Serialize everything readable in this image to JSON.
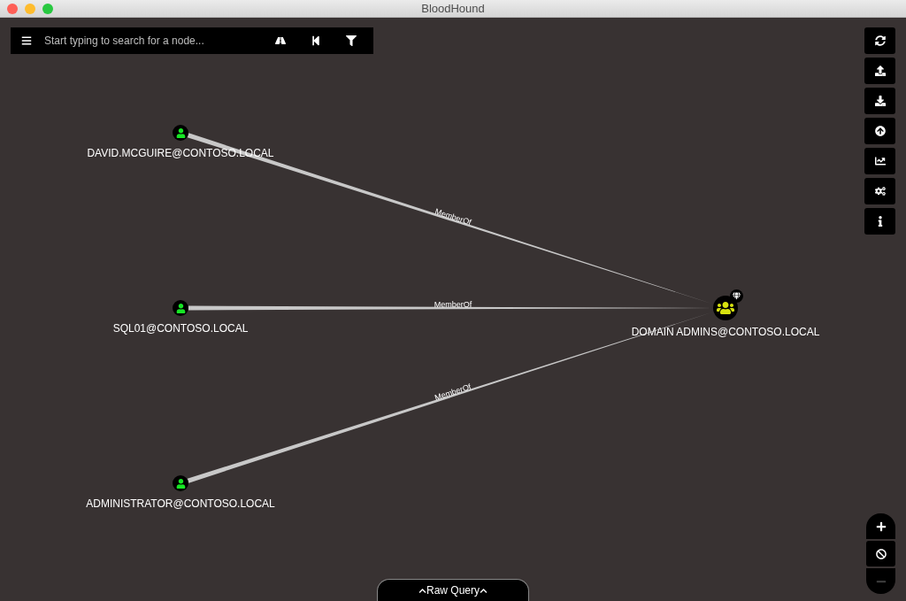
{
  "window": {
    "title": "BloodHound"
  },
  "search": {
    "placeholder": "Start typing to search for a node..."
  },
  "search_tools": [
    {
      "kind": "menu"
    },
    {
      "kind": "pathfinding"
    },
    {
      "kind": "back"
    },
    {
      "kind": "filter"
    }
  ],
  "toolbar": [
    {
      "kind": "refresh"
    },
    {
      "kind": "upload"
    },
    {
      "kind": "download"
    },
    {
      "kind": "import"
    },
    {
      "kind": "stats"
    },
    {
      "kind": "settings"
    },
    {
      "kind": "info"
    }
  ],
  "nodes": [
    {
      "kind": "user",
      "label": "DAVID.MCGUIRE@CONTOSO.LOCAL",
      "high_value": false
    },
    {
      "kind": "user",
      "label": "SQL01@CONTOSO.LOCAL",
      "high_value": false
    },
    {
      "kind": "user",
      "label": "ADMINISTRATOR@CONTOSO.LOCAL",
      "high_value": false
    },
    {
      "kind": "group",
      "label": "DOMAIN ADMINS@CONTOSO.LOCAL",
      "high_value": true
    }
  ],
  "edges": [
    {
      "label": "MemberOf"
    },
    {
      "label": "MemberOf"
    },
    {
      "label": "MemberOf"
    }
  ],
  "zoom_controls": [
    {
      "kind": "zoom_in",
      "disabled": false
    },
    {
      "kind": "reset",
      "disabled": false
    },
    {
      "kind": "zoom_out",
      "disabled": true
    }
  ],
  "raw_query": {
    "label": "Raw Query"
  }
}
